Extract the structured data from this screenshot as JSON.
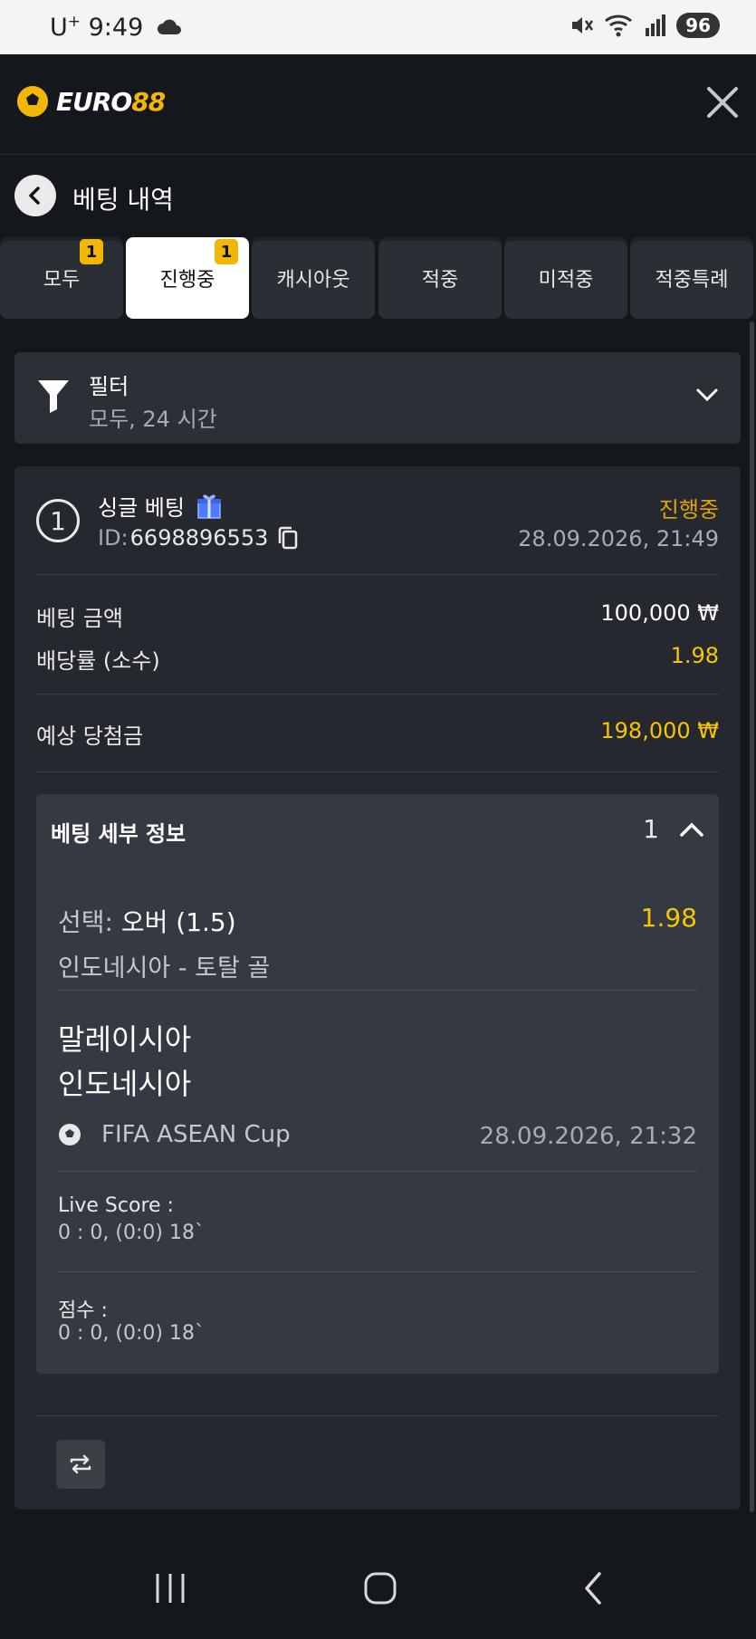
{
  "status_bar": {
    "carrier": "U",
    "carrier_sup": "+",
    "time": "9:49",
    "battery": "96"
  },
  "header": {
    "logo": "EURO88",
    "logo_part1": "EURO",
    "logo_part2": "88"
  },
  "page": {
    "title": "베팅 내역"
  },
  "tabs": [
    {
      "label": "모두",
      "badge": "1"
    },
    {
      "label": "진행중",
      "badge": "1",
      "active": true
    },
    {
      "label": "캐시아웃"
    },
    {
      "label": "적중"
    },
    {
      "label": "미적중"
    },
    {
      "label": "적중특례"
    }
  ],
  "filter": {
    "title": "필터",
    "summary": "모두, 24 시간"
  },
  "bet": {
    "number": "1",
    "type": "싱글 베팅",
    "id_label": "ID:",
    "id": "6698896553",
    "status": "진행중",
    "placed": "28.09.2026, 21:49",
    "stake_label": "베팅 금액",
    "stake": "100,000 ₩",
    "odds_label": "배당률 (소수)",
    "odds": "1.98",
    "payout_label": "예상 당첨금",
    "payout": "198,000 ₩",
    "details": {
      "title": "베팅 세부 정보",
      "count": "1",
      "selection_prefix": "선택:",
      "selection": "오버 (1.5)",
      "selection_odds": "1.98",
      "market": "인도네시아 - 토탈 골",
      "home_team": "말레이시아",
      "away_team": "인도네시아",
      "league": "FIFA ASEAN Cup",
      "match_date": "28.09.2026, 21:32",
      "live_score_label": "Live Score :",
      "live_score": "0 : 0, (0:0) 18`",
      "score_label": "점수 :",
      "score": "0 : 0, (0:0) 18`"
    }
  },
  "colors": {
    "accent": "#f7c600",
    "status_pending": "#e0a500",
    "background": "#14171c",
    "card": "#25282f"
  },
  "icons": [
    "cloud-icon",
    "mute-icon",
    "wifi-icon",
    "signal-icon",
    "soccer-ball-icon",
    "close-icon",
    "back-arrow-icon",
    "filter-funnel-icon",
    "chevron-down-icon",
    "gift-icon",
    "copy-icon",
    "chevron-up-icon",
    "repeat-icon",
    "recent-apps-icon",
    "home-icon",
    "back-nav-icon"
  ]
}
